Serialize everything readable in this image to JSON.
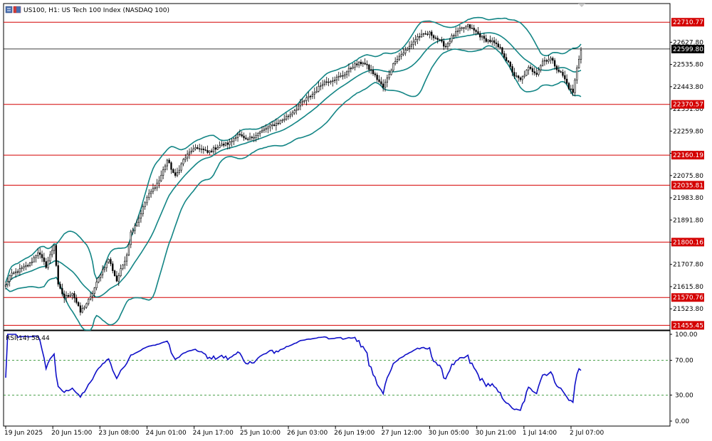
{
  "header": {
    "symbol_title": "US100, H1:  US Tech 100 Index (NASDAQ 100)"
  },
  "rsi_panel": {
    "label": "RSI(14) 58.44"
  },
  "colors": {
    "candle": "#000000",
    "bollinger": "#138585",
    "level_line": "#d40000",
    "current_price_line": "#000000",
    "rsi_line": "#1010c8",
    "rsi_levels": "#148214"
  },
  "chart_data": [
    {
      "type": "candlestick",
      "title": "US100, H1:  US Tech 100 Index (NASDAQ 100)",
      "y_tick_labels": [
        "22627.80",
        "22535.80",
        "22443.80",
        "22351.80",
        "22259.80",
        "22167.80",
        "22075.80",
        "21983.80",
        "21891.80",
        "21799.80",
        "21707.80",
        "21615.80",
        "21523.80"
      ],
      "ylim": [
        21436,
        22788
      ],
      "x_tick_labels": [
        "19 Jun 2025",
        "20 Jun 15:00",
        "23 Jun 08:00",
        "24 Jun 01:00",
        "24 Jun 17:00",
        "25 Jun 10:00",
        "26 Jun 03:00",
        "26 Jun 19:00",
        "27 Jun 12:00",
        "30 Jun 05:00",
        "30 Jun 21:00",
        "1 Jul 14:00",
        "2 Jul 07:00"
      ],
      "horizontal_levels": [
        "22710.77",
        "22370.57",
        "22160.19",
        "22035.81",
        "21800.16",
        "21570.76",
        "21455.45"
      ],
      "current_price": "22599.80",
      "close_anchors": [
        [
          0,
          21620
        ],
        [
          2,
          21660
        ],
        [
          6,
          21680
        ],
        [
          12,
          21710
        ],
        [
          16,
          21760
        ],
        [
          20,
          21700
        ],
        [
          24,
          21790
        ],
        [
          26,
          21620
        ],
        [
          29,
          21570
        ],
        [
          33,
          21590
        ],
        [
          37,
          21510
        ],
        [
          42,
          21570
        ],
        [
          47,
          21670
        ],
        [
          51,
          21730
        ],
        [
          55,
          21640
        ],
        [
          60,
          21750
        ],
        [
          62,
          21840
        ],
        [
          66,
          21900
        ],
        [
          70,
          21985
        ],
        [
          76,
          22055
        ],
        [
          80,
          22140
        ],
        [
          84,
          22070
        ],
        [
          88,
          22140
        ],
        [
          92,
          22180
        ],
        [
          96,
          22190
        ],
        [
          100,
          22170
        ],
        [
          106,
          22200
        ],
        [
          111,
          22210
        ],
        [
          115,
          22250
        ],
        [
          119,
          22220
        ],
        [
          125,
          22250
        ],
        [
          130,
          22275
        ],
        [
          136,
          22300
        ],
        [
          141,
          22330
        ],
        [
          147,
          22380
        ],
        [
          153,
          22420
        ],
        [
          157,
          22460
        ],
        [
          161,
          22470
        ],
        [
          167,
          22490
        ],
        [
          172,
          22530
        ],
        [
          177,
          22545
        ],
        [
          182,
          22500
        ],
        [
          187,
          22440
        ],
        [
          193,
          22555
        ],
        [
          199,
          22600
        ],
        [
          204,
          22650
        ],
        [
          210,
          22665
        ],
        [
          214,
          22640
        ],
        [
          218,
          22610
        ],
        [
          221,
          22650
        ],
        [
          225,
          22680
        ],
        [
          229,
          22695
        ],
        [
          233,
          22670
        ],
        [
          237,
          22640
        ],
        [
          241,
          22630
        ],
        [
          245,
          22600
        ],
        [
          249,
          22540
        ],
        [
          252,
          22490
        ],
        [
          255,
          22470
        ],
        [
          259,
          22520
        ],
        [
          263,
          22500
        ],
        [
          266,
          22550
        ],
        [
          270,
          22560
        ],
        [
          273,
          22520
        ],
        [
          276,
          22490
        ],
        [
          279,
          22440
        ],
        [
          281,
          22420
        ],
        [
          283,
          22520
        ],
        [
          285,
          22600
        ]
      ],
      "candle_count": 286,
      "bollinger_bands": {
        "period": 20,
        "std_dev": 2
      }
    },
    {
      "type": "line",
      "title": "RSI(14) 58.44",
      "ylim": [
        0,
        100
      ],
      "y_tick_labels": [
        "100.00",
        "70.00",
        "30.00",
        "0.00"
      ],
      "levels": [
        70,
        30
      ],
      "current_value": 58.44
    }
  ]
}
